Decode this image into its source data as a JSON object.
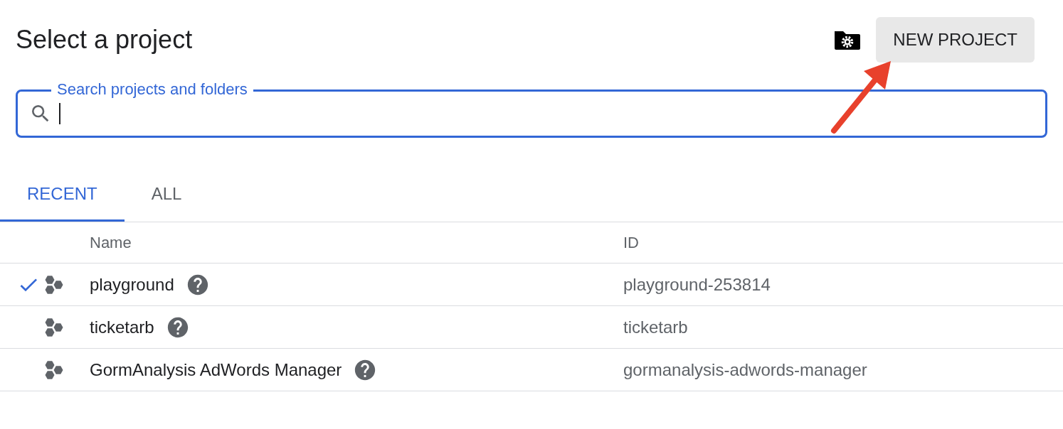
{
  "title": "Select a project",
  "new_project_button": "NEW PROJECT",
  "search": {
    "label": "Search projects and folders",
    "focused": true
  },
  "tabs": [
    {
      "label": "RECENT",
      "selected": true
    },
    {
      "label": "ALL",
      "selected": false
    }
  ],
  "table": {
    "columns": [
      "Name",
      "ID"
    ],
    "rows": [
      {
        "selected": true,
        "name": "playground",
        "id": "playground-253814"
      },
      {
        "selected": false,
        "name": "ticketarb",
        "id": "ticketarb"
      },
      {
        "selected": false,
        "name": "GormAnalysis AdWords Manager",
        "id": "gormanalysis-adwords-manager"
      }
    ]
  }
}
